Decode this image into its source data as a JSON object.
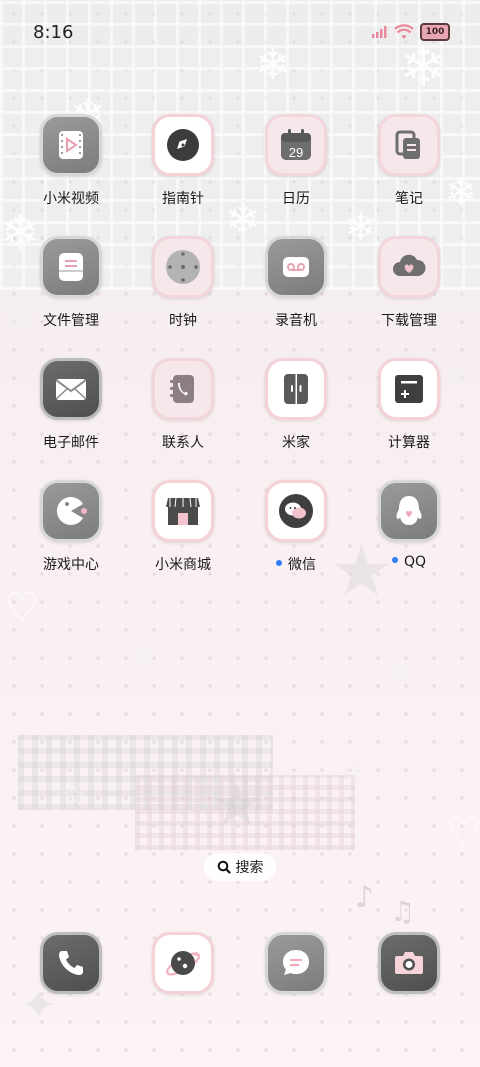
{
  "status_bar": {
    "time": "8:16",
    "battery": "100"
  },
  "apps": [
    {
      "label": "小米视频",
      "icon": "video-icon",
      "badge": false
    },
    {
      "label": "指南针",
      "icon": "compass-icon",
      "badge": false
    },
    {
      "label": "日历",
      "icon": "calendar-icon",
      "badge": false,
      "day": "29"
    },
    {
      "label": "笔记",
      "icon": "notes-icon",
      "badge": false
    },
    {
      "label": "文件管理",
      "icon": "file-manager-icon",
      "badge": false
    },
    {
      "label": "时钟",
      "icon": "clock-icon",
      "badge": false
    },
    {
      "label": "录音机",
      "icon": "recorder-icon",
      "badge": false
    },
    {
      "label": "下载管理",
      "icon": "download-manager-icon",
      "badge": false
    },
    {
      "label": "电子邮件",
      "icon": "email-icon",
      "badge": false
    },
    {
      "label": "联系人",
      "icon": "contacts-icon",
      "badge": false
    },
    {
      "label": "米家",
      "icon": "mijia-icon",
      "badge": false
    },
    {
      "label": "计算器",
      "icon": "calculator-icon",
      "badge": false
    },
    {
      "label": "游戏中心",
      "icon": "game-center-icon",
      "badge": false
    },
    {
      "label": "小米商城",
      "icon": "mi-store-icon",
      "badge": false
    },
    {
      "label": "微信",
      "icon": "wechat-icon",
      "badge": true
    },
    {
      "label": "QQ",
      "icon": "qq-icon",
      "badge": true
    }
  ],
  "search": {
    "label": "搜索"
  },
  "dock": [
    {
      "icon": "phone-icon"
    },
    {
      "icon": "browser-icon"
    },
    {
      "icon": "messages-icon"
    },
    {
      "icon": "camera-icon"
    }
  ]
}
